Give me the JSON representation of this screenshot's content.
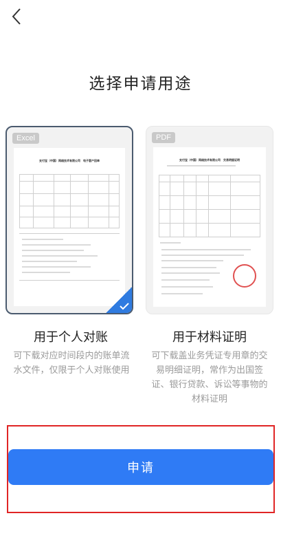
{
  "header": {
    "back_icon": "chevron-left-icon"
  },
  "page": {
    "title": "选择申请用途"
  },
  "options": [
    {
      "format_badge": "Excel",
      "doc_title": "支付宝（中国）网络技术有限公司　电子客户回单",
      "title": "用于个人对账",
      "description": "可下载对应时间段内的账单流水文件，仅限于个人对账使用",
      "selected": true
    },
    {
      "format_badge": "PDF",
      "doc_title": "支付宝（中国）网络技术有限公司　交易明细证明",
      "title": "用于材料证明",
      "description": "可下载盖业务凭证专用章的交易明细证明，常作为出国签证、银行贷款、诉讼等事物的材料证明",
      "selected": false
    }
  ],
  "action": {
    "apply_label": "申请"
  },
  "colors": {
    "accent": "#2f7bf5",
    "highlight": "#e02424"
  }
}
